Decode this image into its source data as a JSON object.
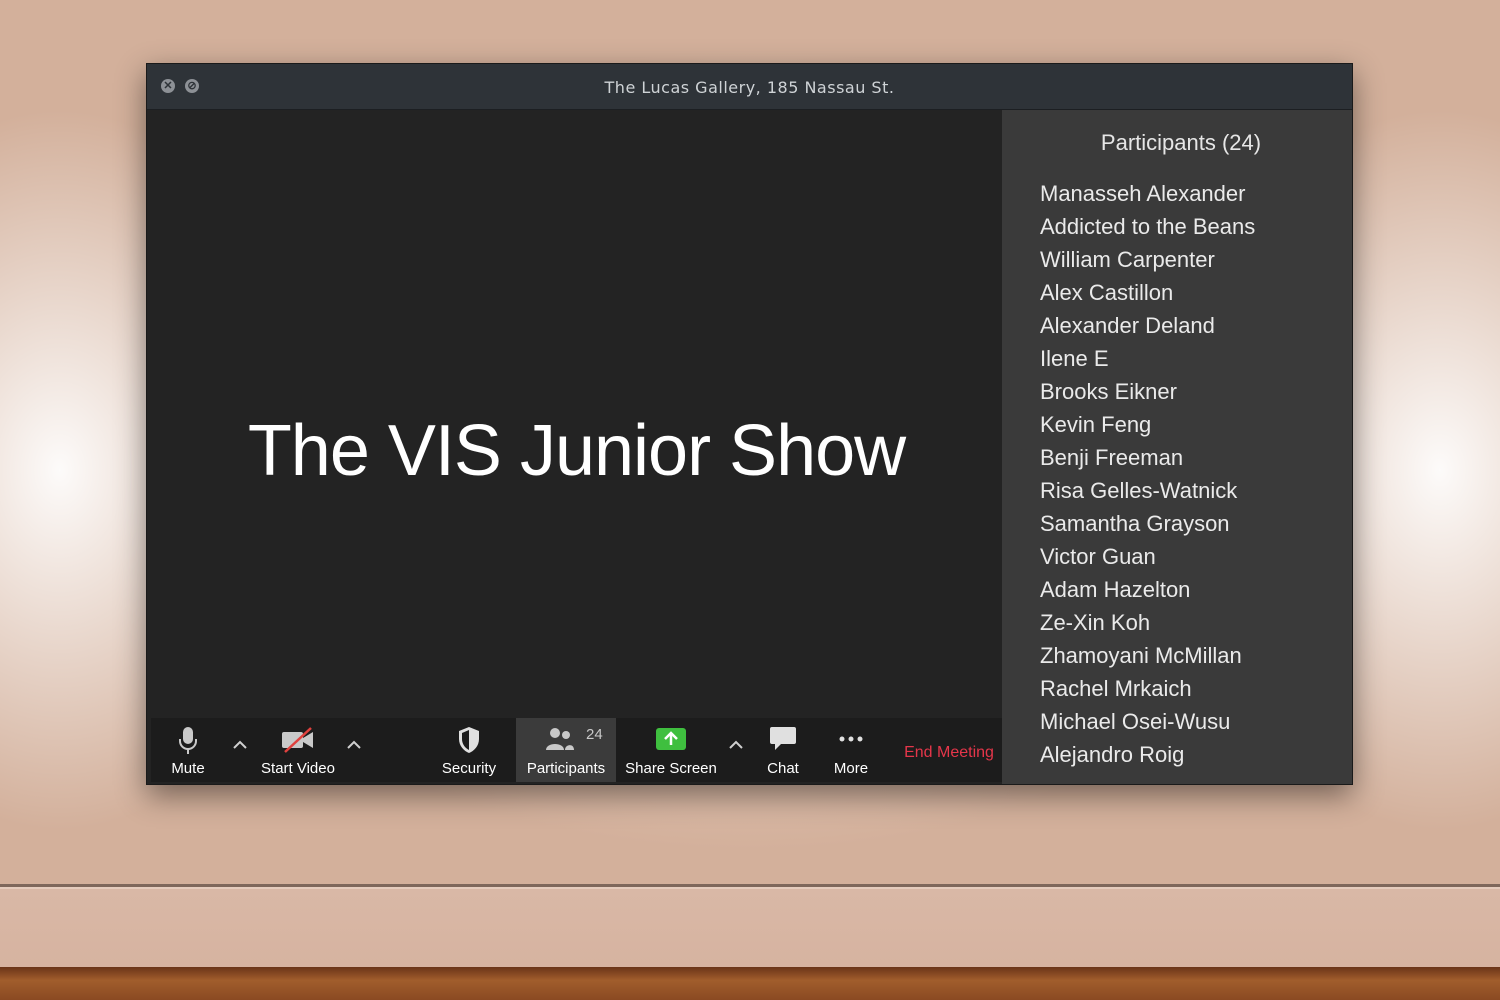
{
  "window": {
    "title": "The Lucas Gallery, 185 Nassau St.",
    "close_glyph": "✕",
    "minimize_glyph": "⊘"
  },
  "stage": {
    "title": "The VIS Junior Show"
  },
  "toolbar": {
    "mute_label": "Mute",
    "start_video_label": "Start Video",
    "security_label": "Security",
    "participants_label": "Participants",
    "participants_count": "24",
    "share_screen_label": "Share Screen",
    "chat_label": "Chat",
    "more_label": "More",
    "end_meeting_label": "End Meeting",
    "icons": {
      "mute": "microphone-icon",
      "video": "video-off-icon",
      "security": "shield-icon",
      "participants": "people-icon",
      "share": "share-screen-arrow-icon",
      "chat": "speech-bubble-icon",
      "more": "ellipsis-icon"
    },
    "colors": {
      "share_green": "#3fbf3f",
      "end_red": "#e5364a",
      "video_off_slash": "#e0413e"
    }
  },
  "participants_panel": {
    "title": "Participants (24)",
    "names": [
      "Manasseh Alexander",
      "Addicted to the Beans",
      "William Carpenter",
      "Alex Castillon",
      "Alexander Deland",
      "Ilene E",
      "Brooks Eikner",
      "Kevin Feng",
      "Benji Freeman",
      "Risa Gelles-Watnick",
      "Samantha Grayson",
      "Victor Guan",
      "Adam Hazelton",
      "Ze-Xin Koh",
      "Zhamoyani McMillan",
      "Rachel Mrkaich",
      "Michael Osei-Wusu",
      "Alejandro Roig"
    ]
  }
}
